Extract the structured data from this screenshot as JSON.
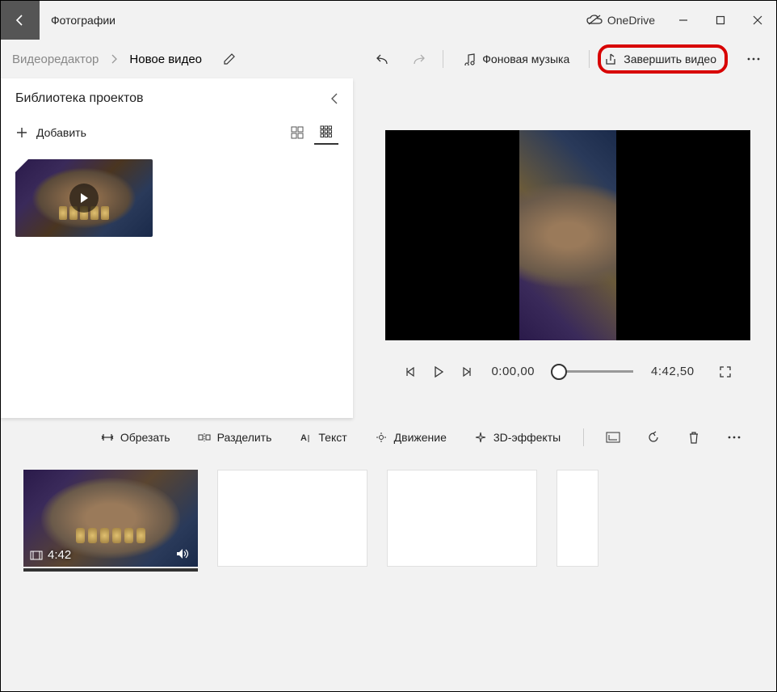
{
  "titlebar": {
    "app_title": "Фотографии",
    "onedrive": "OneDrive"
  },
  "cmdbar": {
    "breadcrumb_root": "Видеоредактор",
    "breadcrumb_current": "Новое видео",
    "bg_music": "Фоновая музыка",
    "finish_video": "Завершить видео"
  },
  "library": {
    "title": "Библиотека проектов",
    "add_label": "Добавить"
  },
  "playback": {
    "current_time": "0:00,00",
    "total_time": "4:42,50"
  },
  "toolbar": {
    "trim": "Обрезать",
    "split": "Разделить",
    "text": "Текст",
    "motion": "Движение",
    "effects3d": "3D-эффекты"
  },
  "storyboard": {
    "clip_duration": "4:42"
  }
}
